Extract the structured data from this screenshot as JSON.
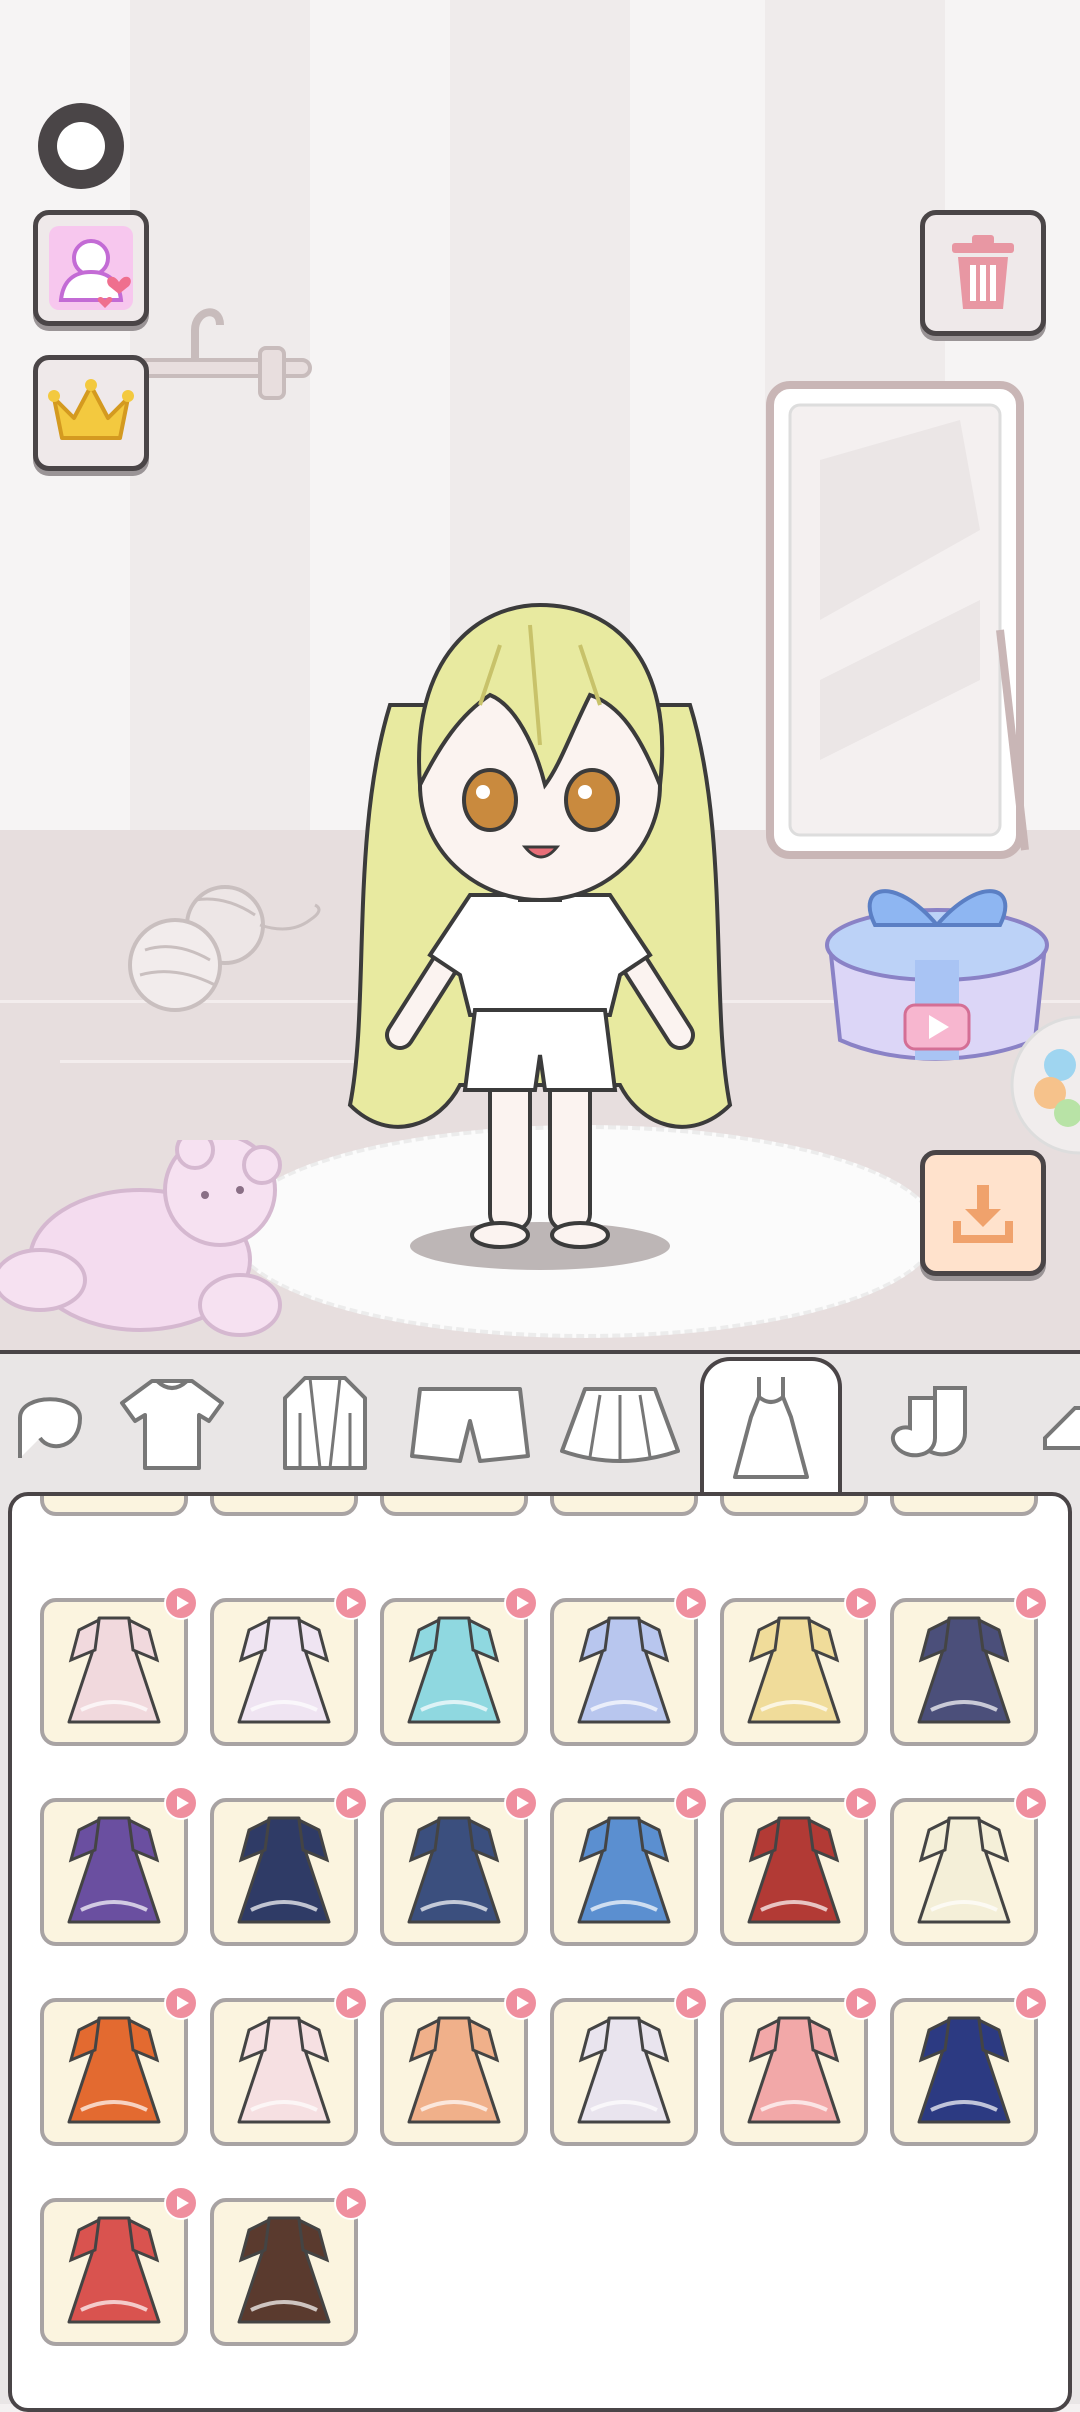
{
  "colors": {
    "outline": "#4a4547",
    "item_bg": "#fbf4df",
    "ad_badge": "#ef8e9e",
    "crown": "#f3c93f",
    "trash": "#e897a3",
    "download": "#f0a26c"
  },
  "left_controls": [
    {
      "icon": "settings-ring-icon"
    },
    {
      "icon": "character-favorite-icon"
    },
    {
      "icon": "crown-vip-icon"
    }
  ],
  "right_controls": [
    {
      "icon": "trash-icon"
    },
    {
      "icon": "gift-video-icon"
    },
    {
      "icon": "download-icon"
    }
  ],
  "category_tabs": [
    {
      "icon": "hair-icon",
      "selected": false
    },
    {
      "icon": "tshirt-icon",
      "selected": false
    },
    {
      "icon": "jacket-icon",
      "selected": false
    },
    {
      "icon": "shorts-icon",
      "selected": false
    },
    {
      "icon": "skirt-icon",
      "selected": false
    },
    {
      "icon": "dress-icon",
      "selected": true
    },
    {
      "icon": "socks-icon",
      "selected": false
    },
    {
      "icon": "shoes-icon",
      "selected": false
    }
  ],
  "dress_items": [
    {
      "icon": "lolita-white-dress-icon",
      "color": "#f1d9dd",
      "ad": true
    },
    {
      "icon": "white-purple-dress-icon",
      "color": "#efe4f2",
      "ad": true
    },
    {
      "icon": "teal-hanfu-dress-icon",
      "color": "#8fd8e0",
      "ad": true
    },
    {
      "icon": "blue-ball-gown-icon",
      "color": "#b8c6ee",
      "ad": true
    },
    {
      "icon": "gold-fairy-dress-icon",
      "color": "#f0dc9a",
      "ad": true
    },
    {
      "icon": "navy-plaid-dress-icon",
      "color": "#4b4f7a",
      "ad": true
    },
    {
      "icon": "purple-black-gown-icon",
      "color": "#6a4fa0",
      "ad": true
    },
    {
      "icon": "navy-gold-dress-icon",
      "color": "#2f3b66",
      "ad": true
    },
    {
      "icon": "butterfly-dress-icon",
      "color": "#3b4f7e",
      "ad": true
    },
    {
      "icon": "blue-bow-dress-icon",
      "color": "#5b8fd0",
      "ad": true
    },
    {
      "icon": "red-gold-dress-icon",
      "color": "#b23a35",
      "ad": true
    },
    {
      "icon": "cream-gown-icon",
      "color": "#f4efd8",
      "ad": true
    },
    {
      "icon": "orange-qipao-icon",
      "color": "#e36a30",
      "ad": true
    },
    {
      "icon": "pink-fur-coat-icon",
      "color": "#f6e0e2",
      "ad": true
    },
    {
      "icon": "peach-hanfu-icon",
      "color": "#f0b08a",
      "ad": true
    },
    {
      "icon": "white-ribbon-gown-icon",
      "color": "#e9e4ee",
      "ad": true
    },
    {
      "icon": "pink-stripe-dress-icon",
      "color": "#f2a8a8",
      "ad": true
    },
    {
      "icon": "starry-blue-gown-icon",
      "color": "#2c3a82",
      "ad": true
    },
    {
      "icon": "red-floral-dress-icon",
      "color": "#d9534f",
      "ad": true
    },
    {
      "icon": "kimono-coat-icon",
      "color": "#5a3a2e",
      "ad": true
    }
  ]
}
